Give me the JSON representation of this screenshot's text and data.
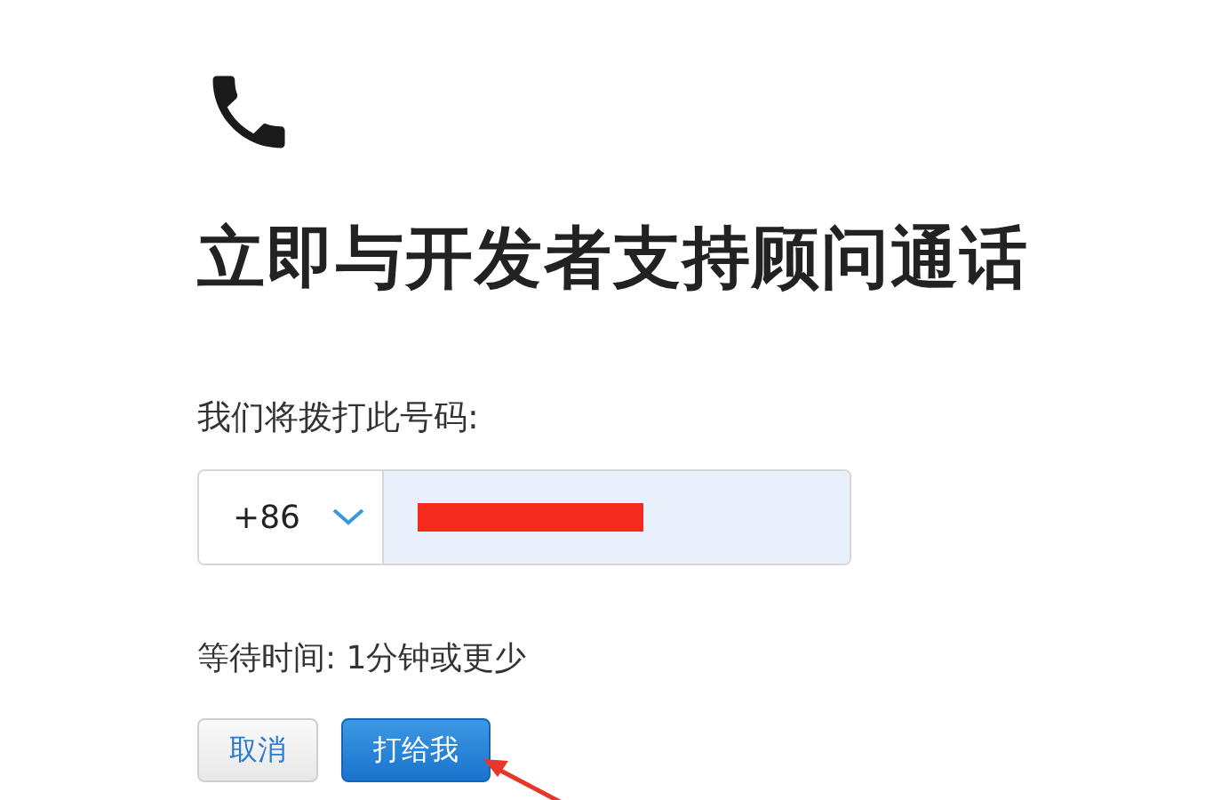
{
  "heading": "立即与开发者支持顾问通话",
  "phone_label": "我们将拨打此号码:",
  "country_code": {
    "value": "+86"
  },
  "phone_field": {
    "redacted": true
  },
  "wait_time": "等待时间: 1分钟或更少",
  "buttons": [
    {
      "label": "取消",
      "kind": "secondary"
    },
    {
      "label": "打给我",
      "kind": "primary"
    }
  ],
  "annotation_arrow": true
}
